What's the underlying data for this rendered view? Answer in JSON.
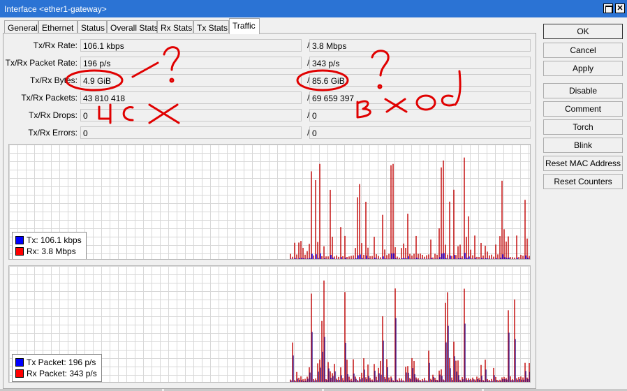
{
  "window": {
    "title": "Interface <ether1-gateway>"
  },
  "tabs": [
    {
      "label": "General"
    },
    {
      "label": "Ethernet"
    },
    {
      "label": "Status"
    },
    {
      "label": "Overall Stats"
    },
    {
      "label": "Rx Stats"
    },
    {
      "label": "Tx Stats"
    },
    {
      "label": "Traffic",
      "active": true
    }
  ],
  "stats": [
    {
      "label": "Tx/Rx Rate:",
      "tx": "106.1 kbps",
      "rx": "3.8 Mbps"
    },
    {
      "label": "Tx/Rx Packet Rate:",
      "tx": "196 p/s",
      "rx": "343 p/s"
    },
    {
      "label": "Tx/Rx Bytes:",
      "tx": "4.9 GiB",
      "rx": "85.6 GiB"
    },
    {
      "label": "Tx/Rx Packets:",
      "tx": "43 810 418",
      "rx": "69 659 397"
    },
    {
      "label": "Tx/Rx Drops:",
      "tx": "0",
      "rx": "0"
    },
    {
      "label": "Tx/Rx Errors:",
      "tx": "0",
      "rx": "0"
    }
  ],
  "separator": "/",
  "graph_bytes": {
    "legend": [
      {
        "label": "Tx:  106.1 kbps",
        "color": "#0000ff"
      },
      {
        "label": "Rx:  3.8 Mbps",
        "color": "#ff0000"
      }
    ]
  },
  "graph_packets": {
    "legend": [
      {
        "label": "Tx Packet:  196 p/s",
        "color": "#0000ff"
      },
      {
        "label": "Rx Packet:  343 p/s",
        "color": "#ff0000"
      }
    ]
  },
  "buttons": {
    "ok": "OK",
    "cancel": "Cancel",
    "apply": "Apply",
    "disable": "Disable",
    "comment": "Comment",
    "torch": "Torch",
    "blink": "Blink",
    "reset_mac": "Reset MAC Address",
    "reset_counters": "Reset Counters"
  },
  "colors": {
    "tx": "#0000ff",
    "rx": "#c00000",
    "annotation": "#e00000",
    "titlebar": "#2b73d4"
  },
  "annotation_text": "Handwritten red marker marks: '?', 'исх' and 'вход'"
}
